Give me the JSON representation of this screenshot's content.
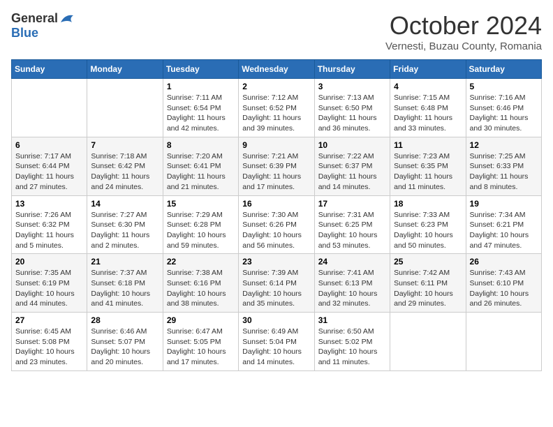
{
  "logo": {
    "general": "General",
    "blue": "Blue"
  },
  "title": {
    "month": "October 2024",
    "location": "Vernesti, Buzau County, Romania"
  },
  "weekdays": [
    "Sunday",
    "Monday",
    "Tuesday",
    "Wednesday",
    "Thursday",
    "Friday",
    "Saturday"
  ],
  "weeks": [
    [
      {
        "day": "",
        "info": ""
      },
      {
        "day": "",
        "info": ""
      },
      {
        "day": "1",
        "info": "Sunrise: 7:11 AM\nSunset: 6:54 PM\nDaylight: 11 hours and 42 minutes."
      },
      {
        "day": "2",
        "info": "Sunrise: 7:12 AM\nSunset: 6:52 PM\nDaylight: 11 hours and 39 minutes."
      },
      {
        "day": "3",
        "info": "Sunrise: 7:13 AM\nSunset: 6:50 PM\nDaylight: 11 hours and 36 minutes."
      },
      {
        "day": "4",
        "info": "Sunrise: 7:15 AM\nSunset: 6:48 PM\nDaylight: 11 hours and 33 minutes."
      },
      {
        "day": "5",
        "info": "Sunrise: 7:16 AM\nSunset: 6:46 PM\nDaylight: 11 hours and 30 minutes."
      }
    ],
    [
      {
        "day": "6",
        "info": "Sunrise: 7:17 AM\nSunset: 6:44 PM\nDaylight: 11 hours and 27 minutes."
      },
      {
        "day": "7",
        "info": "Sunrise: 7:18 AM\nSunset: 6:42 PM\nDaylight: 11 hours and 24 minutes."
      },
      {
        "day": "8",
        "info": "Sunrise: 7:20 AM\nSunset: 6:41 PM\nDaylight: 11 hours and 21 minutes."
      },
      {
        "day": "9",
        "info": "Sunrise: 7:21 AM\nSunset: 6:39 PM\nDaylight: 11 hours and 17 minutes."
      },
      {
        "day": "10",
        "info": "Sunrise: 7:22 AM\nSunset: 6:37 PM\nDaylight: 11 hours and 14 minutes."
      },
      {
        "day": "11",
        "info": "Sunrise: 7:23 AM\nSunset: 6:35 PM\nDaylight: 11 hours and 11 minutes."
      },
      {
        "day": "12",
        "info": "Sunrise: 7:25 AM\nSunset: 6:33 PM\nDaylight: 11 hours and 8 minutes."
      }
    ],
    [
      {
        "day": "13",
        "info": "Sunrise: 7:26 AM\nSunset: 6:32 PM\nDaylight: 11 hours and 5 minutes."
      },
      {
        "day": "14",
        "info": "Sunrise: 7:27 AM\nSunset: 6:30 PM\nDaylight: 11 hours and 2 minutes."
      },
      {
        "day": "15",
        "info": "Sunrise: 7:29 AM\nSunset: 6:28 PM\nDaylight: 10 hours and 59 minutes."
      },
      {
        "day": "16",
        "info": "Sunrise: 7:30 AM\nSunset: 6:26 PM\nDaylight: 10 hours and 56 minutes."
      },
      {
        "day": "17",
        "info": "Sunrise: 7:31 AM\nSunset: 6:25 PM\nDaylight: 10 hours and 53 minutes."
      },
      {
        "day": "18",
        "info": "Sunrise: 7:33 AM\nSunset: 6:23 PM\nDaylight: 10 hours and 50 minutes."
      },
      {
        "day": "19",
        "info": "Sunrise: 7:34 AM\nSunset: 6:21 PM\nDaylight: 10 hours and 47 minutes."
      }
    ],
    [
      {
        "day": "20",
        "info": "Sunrise: 7:35 AM\nSunset: 6:19 PM\nDaylight: 10 hours and 44 minutes."
      },
      {
        "day": "21",
        "info": "Sunrise: 7:37 AM\nSunset: 6:18 PM\nDaylight: 10 hours and 41 minutes."
      },
      {
        "day": "22",
        "info": "Sunrise: 7:38 AM\nSunset: 6:16 PM\nDaylight: 10 hours and 38 minutes."
      },
      {
        "day": "23",
        "info": "Sunrise: 7:39 AM\nSunset: 6:14 PM\nDaylight: 10 hours and 35 minutes."
      },
      {
        "day": "24",
        "info": "Sunrise: 7:41 AM\nSunset: 6:13 PM\nDaylight: 10 hours and 32 minutes."
      },
      {
        "day": "25",
        "info": "Sunrise: 7:42 AM\nSunset: 6:11 PM\nDaylight: 10 hours and 29 minutes."
      },
      {
        "day": "26",
        "info": "Sunrise: 7:43 AM\nSunset: 6:10 PM\nDaylight: 10 hours and 26 minutes."
      }
    ],
    [
      {
        "day": "27",
        "info": "Sunrise: 6:45 AM\nSunset: 5:08 PM\nDaylight: 10 hours and 23 minutes."
      },
      {
        "day": "28",
        "info": "Sunrise: 6:46 AM\nSunset: 5:07 PM\nDaylight: 10 hours and 20 minutes."
      },
      {
        "day": "29",
        "info": "Sunrise: 6:47 AM\nSunset: 5:05 PM\nDaylight: 10 hours and 17 minutes."
      },
      {
        "day": "30",
        "info": "Sunrise: 6:49 AM\nSunset: 5:04 PM\nDaylight: 10 hours and 14 minutes."
      },
      {
        "day": "31",
        "info": "Sunrise: 6:50 AM\nSunset: 5:02 PM\nDaylight: 10 hours and 11 minutes."
      },
      {
        "day": "",
        "info": ""
      },
      {
        "day": "",
        "info": ""
      }
    ]
  ]
}
